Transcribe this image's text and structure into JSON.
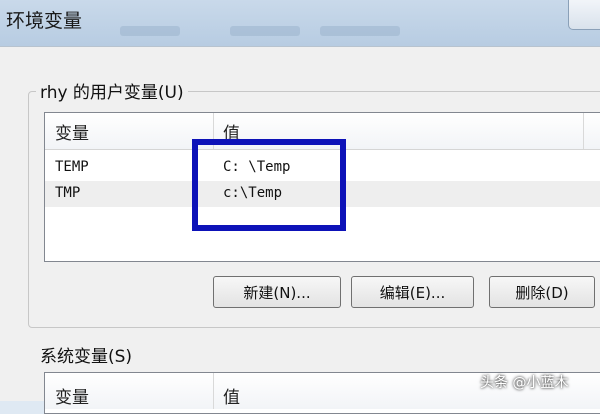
{
  "window": {
    "title": "环境变量"
  },
  "user_vars": {
    "label": "rhy 的用户变量(U)",
    "columns": [
      "变量",
      "值"
    ],
    "rows": [
      {
        "name": "TEMP",
        "value": "C: \\Temp"
      },
      {
        "name": "TMP",
        "value": "c:\\Temp"
      }
    ],
    "buttons": {
      "new": "新建(N)...",
      "edit": "编辑(E)...",
      "delete": "删除(D)"
    }
  },
  "system_vars": {
    "label": "系统变量(S)",
    "columns": [
      "变量",
      "值"
    ]
  },
  "watermark": "头条 @小蓝木",
  "colors": {
    "highlight": "#0d12b8"
  }
}
